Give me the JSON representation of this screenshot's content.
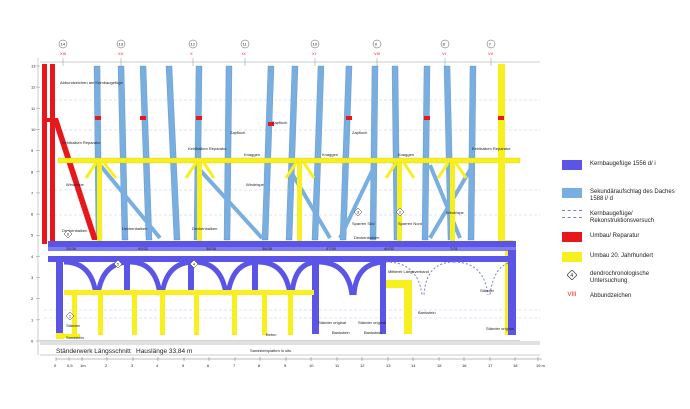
{
  "axis_labels": [
    {
      "id": "0",
      "text": "0"
    },
    {
      "id": "05",
      "text": "0,5"
    },
    {
      "id": "1m",
      "text": "1m"
    },
    {
      "id": "2",
      "text": "2"
    },
    {
      "id": "3",
      "text": "3"
    },
    {
      "id": "4",
      "text": "4"
    },
    {
      "id": "5",
      "text": "5"
    },
    {
      "id": "6",
      "text": "6"
    },
    {
      "id": "7",
      "text": "7"
    },
    {
      "id": "8",
      "text": "8"
    },
    {
      "id": "9",
      "text": "9"
    },
    {
      "id": "10",
      "text": "10"
    },
    {
      "id": "11",
      "text": "11"
    },
    {
      "id": "12",
      "text": "12"
    },
    {
      "id": "13",
      "text": "13"
    },
    {
      "id": "14",
      "text": "14"
    },
    {
      "id": "15",
      "text": "15"
    },
    {
      "id": "16",
      "text": "16"
    },
    {
      "id": "17",
      "text": "17"
    },
    {
      "id": "18",
      "text": "18"
    },
    {
      "id": "19m",
      "text": "19 m"
    }
  ],
  "axis_numbers": [
    "14",
    "13",
    "12",
    "11",
    "10",
    "9",
    "8",
    "7"
  ],
  "roman_numbers": [
    "XIII",
    "XII",
    "X",
    "IX",
    "XI",
    "VIII",
    "VI",
    "VII"
  ],
  "annotations": {
    "abbund_am_kern": "Abbundzeichen am Kernbaugefüge",
    "kehlbalken_rep_1": "Kehlbalken Reparatur",
    "kehlbalken_rep_2": "Kehlbalken Reparatur",
    "kehlbalken_rep_3": "Kehlbalken Reparatur",
    "zapfloch_1": "Zapfloch",
    "zapfloch_2": "Zapfloch",
    "zapfloch_3": "Zapfloch",
    "knaggen_1": "Knaggen",
    "knaggen_2": "Knaggen",
    "knaggen_3": "Knaggen",
    "windrispe_1": "Windrispe",
    "windrispe_2": "Windrispe",
    "windrispe_3": "Windrispe",
    "deckenbalken_1": "Deckenbalken",
    "deckenbalken_2": "Deckenbalken",
    "deckenbalken_3": "Deckenbalken",
    "deckenbalken_4": "Deckenbalken",
    "sparrenkopf_1": "Sparren Süd",
    "sparrenkopf_2": "Sparren Nord",
    "unterzug": "Unterzug",
    "staender": "Ständer",
    "staender_2": "Ständer",
    "staender_original": "Ständer original",
    "staender_original_2": "Ständer original",
    "staender_original_3": "Ständer original",
    "mittlerer_laengsverband": "Mittlerer Längsverband",
    "bankenstuetze": "Bankstein",
    "bankenstuetze_2": "Bankstein",
    "bankenstuetze_3": "Bankstein",
    "stahltraeger": "Stahlträger",
    "sandstein": "Sandstein",
    "beton": "Beton",
    "betonfundament": "Beton",
    "balken_1": "25/36",
    "balken_2": "40/32",
    "balken_3": "36/36",
    "balken_4": "38/38",
    "balken_5": "47/30",
    "balken_6": "40/32",
    "balken_7": "7/31",
    "bodenplatte": "Sandsteinplatten in situ"
  },
  "dendro_numbers": {
    "d1": "6",
    "d2": "5",
    "d3": "4",
    "d4": "3",
    "d5": "2",
    "d6": "1"
  },
  "height_labels": [
    "13",
    "12",
    "11",
    "10",
    "9",
    "8",
    "7",
    "6",
    "5",
    "4",
    "3",
    "2",
    "1",
    "0"
  ],
  "legend": [
    {
      "id": "kern",
      "label": "Kernbaugefüge 1556 d/ i",
      "color": "#5a55e6"
    },
    {
      "id": "sekundaer",
      "label": "Sekundäraufschlag des Daches 1588 i/ d",
      "color": "#79aee0"
    },
    {
      "id": "rekonstruktion",
      "label": "Kernbaugefüge/ Rekonstruktionsversuch",
      "color": "#7a7ad8"
    },
    {
      "id": "umbau",
      "label": "Umbau/ Reparatur",
      "color": "#e8171b"
    },
    {
      "id": "umbau20",
      "label": "Umbau 20. Jahrhundert",
      "color": "#f7ef1e"
    },
    {
      "id": "dendro",
      "label": "dendrochronologische Untersuchung",
      "glyph": "4"
    },
    {
      "id": "abbund",
      "label": "Abbundzeichen",
      "glyph": "VIII"
    }
  ],
  "caption_left": "Ständerwerk Längsschnitt",
  "caption_right": "Hauslänge 33,84 m"
}
